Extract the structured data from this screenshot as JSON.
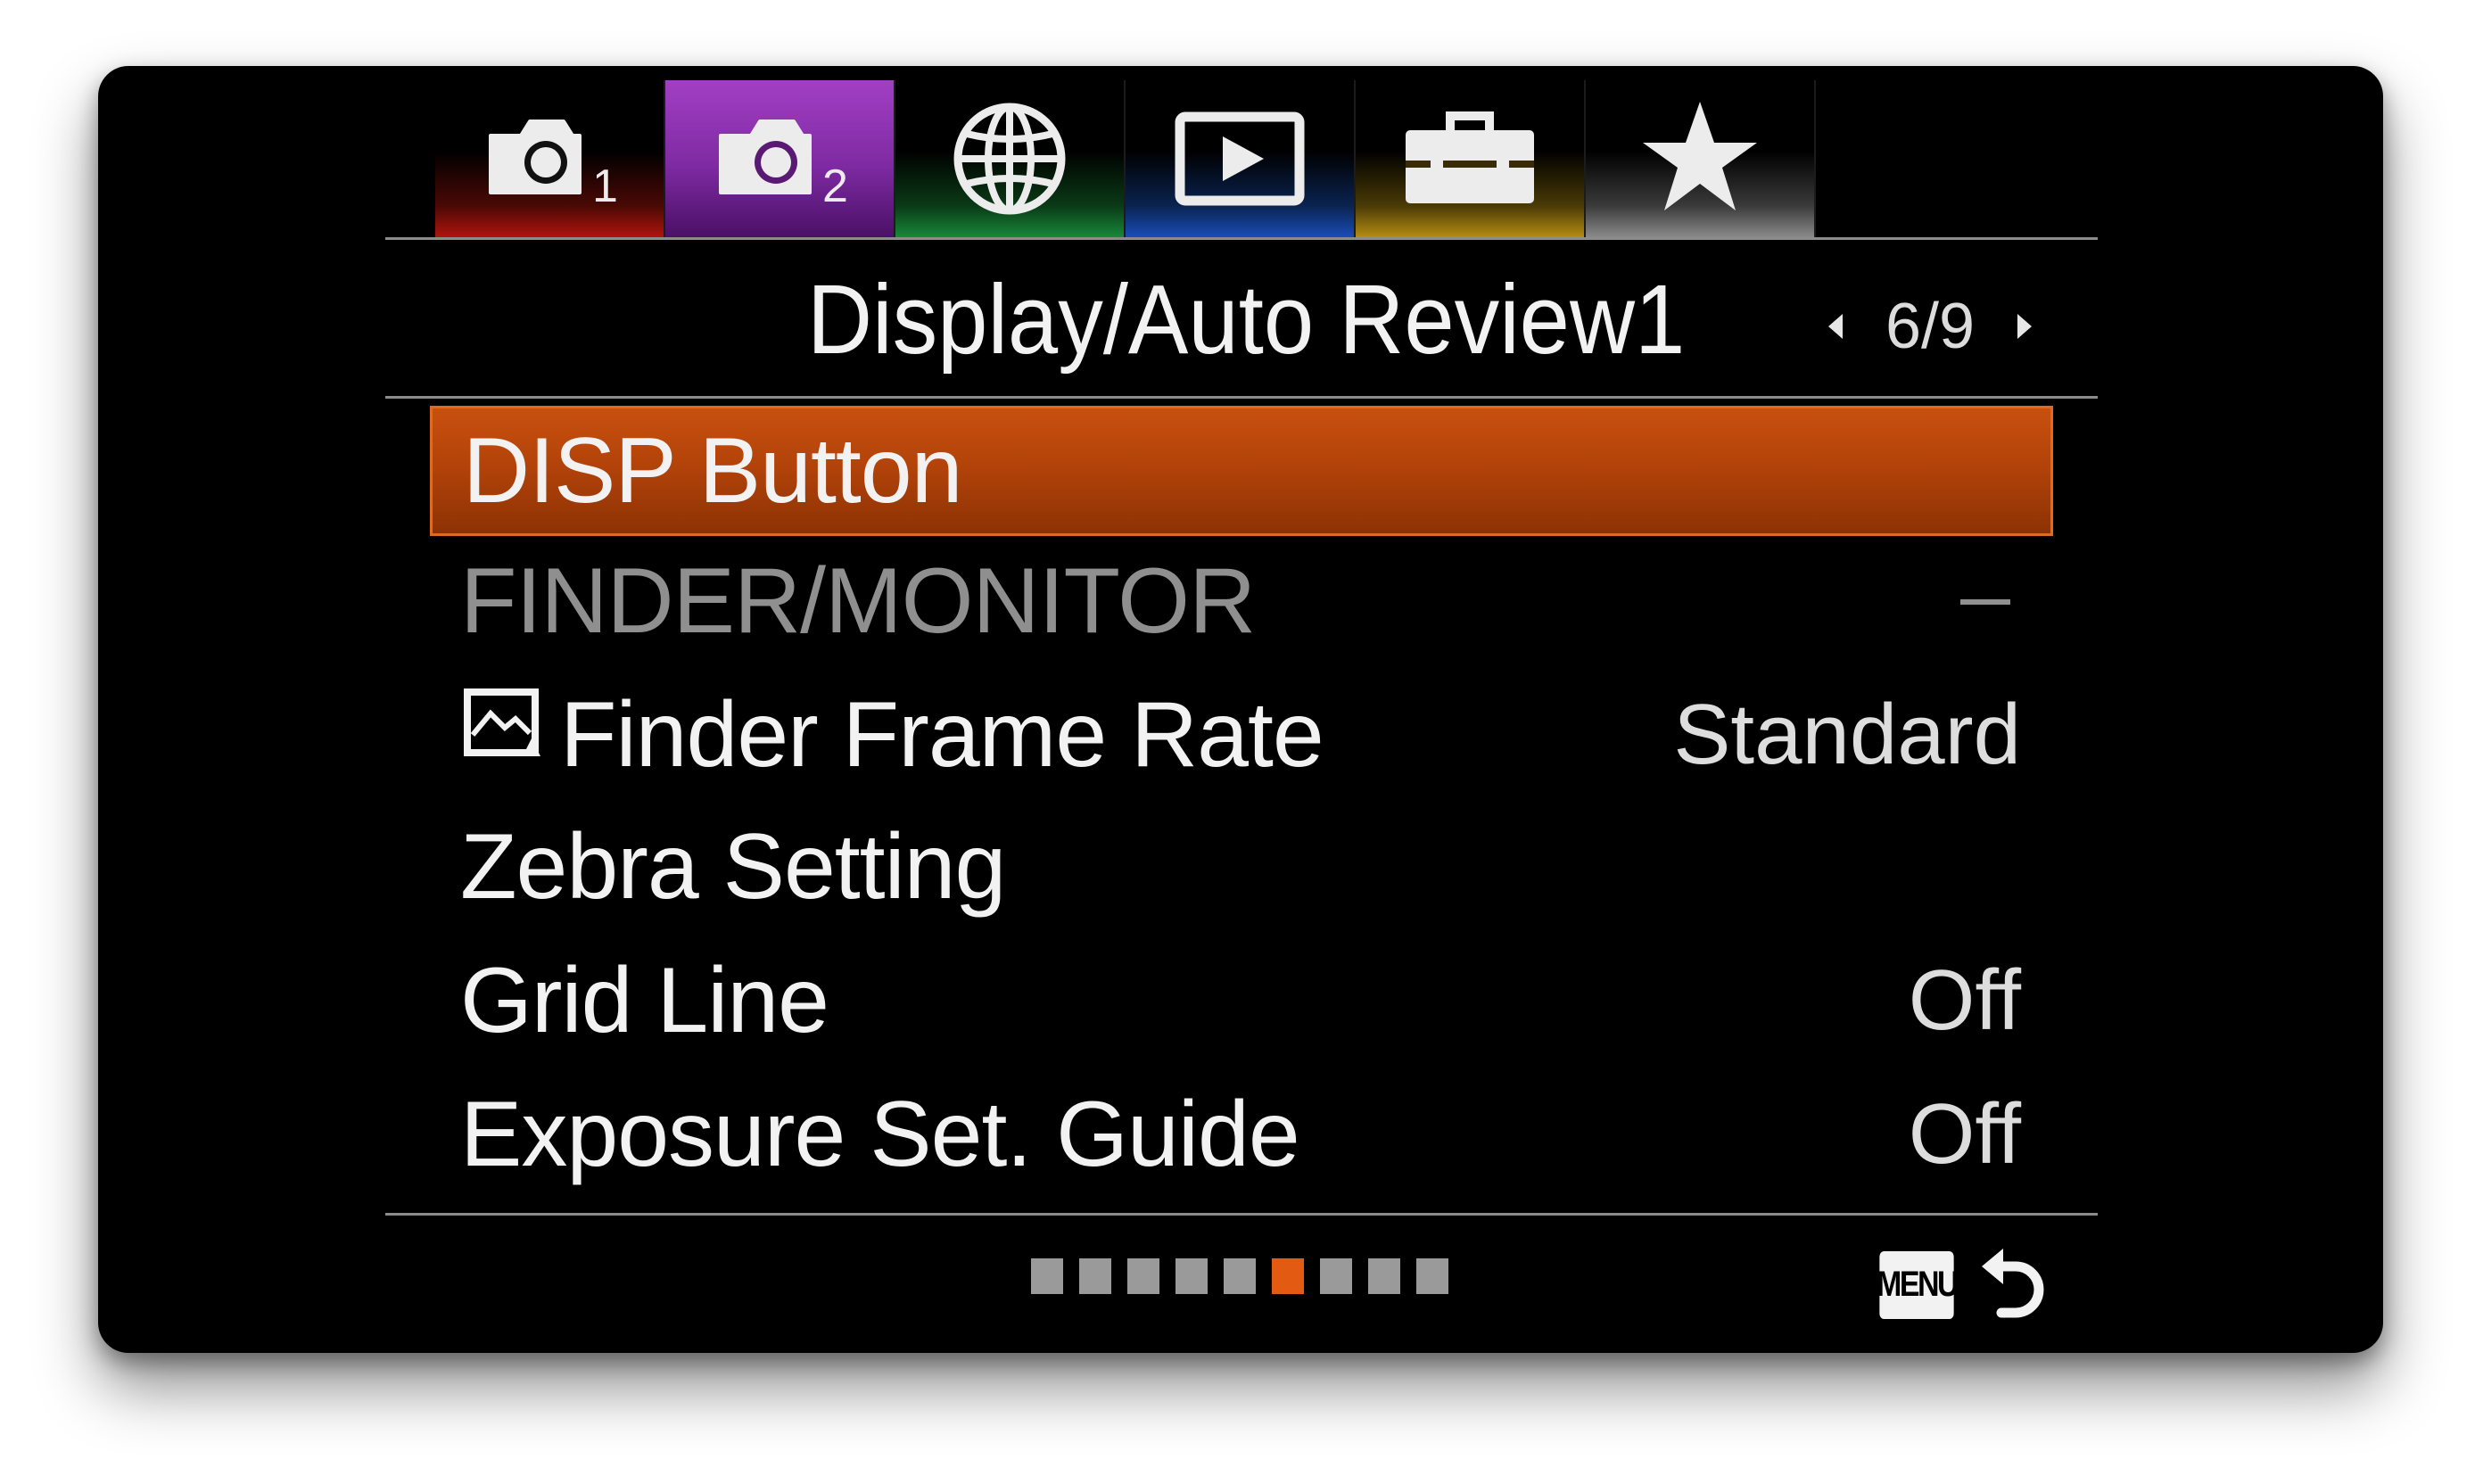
{
  "tabs": [
    {
      "icon": "camera-icon",
      "number": "1",
      "color": "#c41a12",
      "active": false
    },
    {
      "icon": "camera-icon",
      "number": "2",
      "color": "#8a2aa8",
      "active": true
    },
    {
      "icon": "globe-icon",
      "number": "",
      "color": "#1c8a3a",
      "active": false
    },
    {
      "icon": "playback-icon",
      "number": "",
      "color": "#1c4fb8",
      "active": false
    },
    {
      "icon": "toolbox-icon",
      "number": "",
      "color": "#c79a10",
      "active": false
    },
    {
      "icon": "star-icon",
      "number": "",
      "color": "#8a8a8a",
      "active": false
    }
  ],
  "header": {
    "title": "Display/Auto Review1",
    "page": "6/9"
  },
  "menu": {
    "items": [
      {
        "label": "DISP Button",
        "value": "",
        "selected": true
      },
      {
        "label": "FINDER/MONITOR",
        "value": "—",
        "disabled": true
      },
      {
        "label": "Finder Frame Rate",
        "value": "Standard",
        "icon": "movie-mode-icon"
      },
      {
        "label": "Zebra Setting",
        "value": ""
      },
      {
        "label": "Grid Line",
        "value": "Off"
      },
      {
        "label": "Exposure Set. Guide",
        "value": "Off"
      }
    ]
  },
  "pagination": {
    "total": 9,
    "current": 6
  },
  "footer": {
    "menu_label": "MENU",
    "accent": "#e35a12"
  }
}
